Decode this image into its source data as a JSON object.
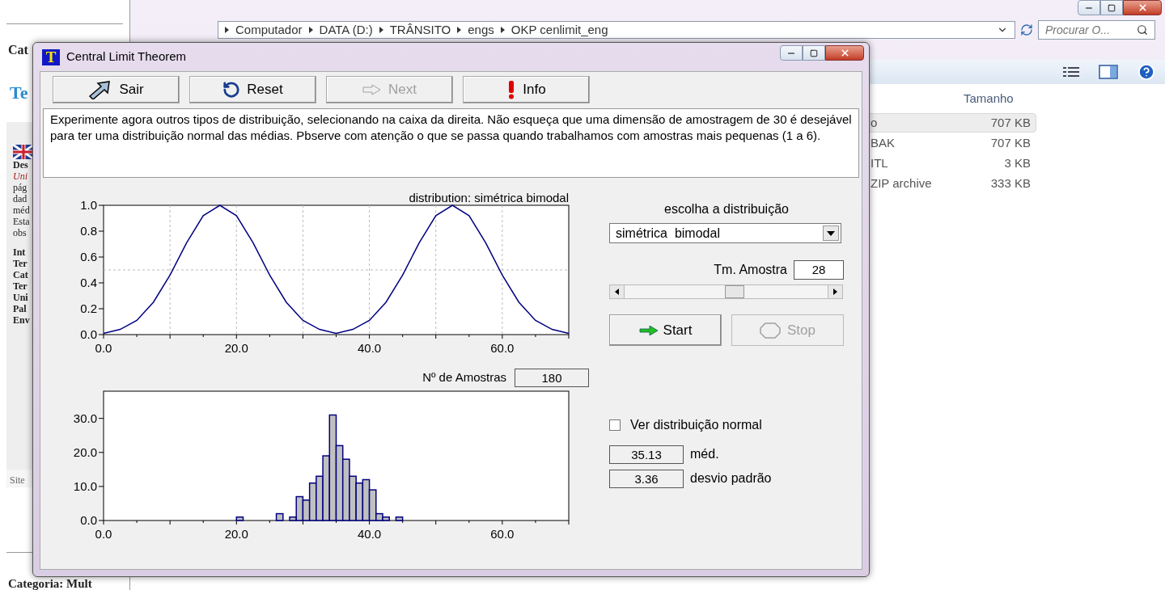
{
  "web_page": {
    "top_label": "Cat",
    "heading": "Te",
    "lines": [
      {
        "text": "Des",
        "kind": "bold"
      },
      {
        "text": "Uni",
        "kind": "italic"
      },
      {
        "text": "pág",
        "kind": "plain"
      },
      {
        "text": "dad",
        "kind": "plain"
      },
      {
        "text": "méd",
        "kind": "plain"
      },
      {
        "text": "Esta",
        "kind": "plain"
      },
      {
        "text": "obs",
        "kind": "plain"
      },
      {
        "text": "Int",
        "kind": "gap"
      },
      {
        "text": "Ter",
        "kind": "bold"
      },
      {
        "text": "Cat",
        "kind": "bold"
      },
      {
        "text": "Ter",
        "kind": "bold"
      },
      {
        "text": "Uni",
        "kind": "bold"
      },
      {
        "text": "Pal",
        "kind": "bold"
      },
      {
        "text": "Env",
        "kind": "bold"
      }
    ],
    "footer": "Site",
    "bottom_label": "Categoria: Mult"
  },
  "explorer": {
    "breadcrumb": [
      "Computador",
      "DATA (D:)",
      "TRÂNSITO",
      "engs",
      "OKP cenlimit_eng"
    ],
    "search": {
      "placeholder": "Procurar O..."
    },
    "column_header": "Tamanho",
    "rows": [
      {
        "type": "o",
        "size": "707 KB",
        "selected": true
      },
      {
        "type": "BAK",
        "size": "707 KB",
        "selected": false
      },
      {
        "type": "ITL",
        "size": "3 KB",
        "selected": false
      },
      {
        "type": "ZIP archive",
        "size": "333 KB",
        "selected": false
      }
    ]
  },
  "dialog": {
    "icon_letter": "T",
    "title": "Central Limit Theorem",
    "toolbar": [
      {
        "label": "Sair",
        "kind": "exit",
        "disabled": false
      },
      {
        "label": "Reset",
        "kind": "reset",
        "disabled": false
      },
      {
        "label": "Next",
        "kind": "next",
        "disabled": true
      },
      {
        "label": "Info",
        "kind": "info",
        "disabled": false
      }
    ],
    "message": "Experimente agora outros tipos de distribuição, selecionando na caixa da direita. Não esqueça que uma dimensão de amostragem de 30 é desejável para ter uma distribuição normal das médias. Pbserve com atenção o que se passa quando trabalhamos com amostras mais pequenas (1 a 6).",
    "distribution_chart": {
      "chart_data": {
        "type": "line",
        "title": "distribution: simétrica  bimodal",
        "x": [
          0,
          2.5,
          5,
          7.5,
          10,
          12.5,
          15,
          17.5,
          20,
          22.5,
          25,
          27.5,
          30,
          32.5,
          35,
          37.5,
          40,
          42.5,
          45,
          47.5,
          50,
          52.5,
          55,
          57.5,
          60,
          62.5,
          65,
          67.5,
          70
        ],
        "grid": true,
        "series": [
          {
            "color": "#000080",
            "values": [
              0.01,
              0.04,
              0.11,
              0.25,
              0.46,
              0.71,
              0.92,
              1,
              0.92,
              0.71,
              0.46,
              0.25,
              0.11,
              0.04,
              0.01,
              0.04,
              0.11,
              0.25,
              0.46,
              0.71,
              0.92,
              1,
              0.92,
              0.71,
              0.46,
              0.25,
              0.11,
              0.04,
              0.01
            ]
          }
        ],
        "xlim": [
          0,
          70
        ],
        "ylim": [
          0,
          1
        ],
        "xticks": [
          {
            "value": 0,
            "label": "0.0"
          },
          {
            "value": 20,
            "label": "20.0"
          },
          {
            "value": 40,
            "label": "40.0"
          },
          {
            "value": 60,
            "label": "60.0"
          }
        ],
        "yticks": [
          {
            "value": 0,
            "label": "0.0"
          },
          {
            "value": 0.2,
            "label": "0.2"
          },
          {
            "value": 0.4,
            "label": "0.4"
          },
          {
            "value": 0.6,
            "label": "0.6"
          },
          {
            "value": 0.8,
            "label": "0.8"
          },
          {
            "value": 1,
            "label": "1.0"
          }
        ]
      }
    },
    "samples_label": "Nº de Amostras",
    "samples_value": "180",
    "histogram": {
      "chart_data": {
        "type": "bar",
        "x": [
          20.5,
          26.5,
          28.5,
          29.5,
          30.5,
          31.5,
          32.5,
          33.5,
          34.5,
          35.5,
          36.5,
          37.5,
          38.5,
          39.5,
          40.5,
          41.5,
          42.5,
          44.5
        ],
        "grid": false,
        "series": [
          {
            "color": "#c0c0c0",
            "values": [
              1,
              2,
              1,
              7,
              6,
              11,
              13,
              19,
              31,
              22,
              18,
              13,
              11,
              12,
              9,
              2,
              1,
              1
            ]
          }
        ],
        "xlim": [
          0,
          70
        ],
        "ylim": [
          0,
          38
        ],
        "xticks": [
          {
            "value": 0,
            "label": "0.0"
          },
          {
            "value": 20,
            "label": "20.0"
          },
          {
            "value": 40,
            "label": "40.0"
          },
          {
            "value": 60,
            "label": "60.0"
          }
        ],
        "yticks": [
          {
            "value": 0,
            "label": "0.0"
          },
          {
            "value": 10,
            "label": "10.0"
          },
          {
            "value": 20,
            "label": "20.0"
          },
          {
            "value": 30,
            "label": "30.0"
          }
        ]
      }
    },
    "choose_label": "escolha a distribuição",
    "distribution_value": "simétrica  bimodal",
    "sample_size_label": "Tm. Amostra",
    "sample_size_value": "28",
    "sample_slider": {
      "level": 0.54
    },
    "start": {
      "label": "Start",
      "disabled": false
    },
    "stop": {
      "label": "Stop",
      "disabled": true
    },
    "normal_checkbox": {
      "label": "Ver distribuição normal",
      "checked": false
    },
    "stats": [
      {
        "value": "35.13",
        "label": "méd."
      },
      {
        "value": "3.36",
        "label": "desvio padrão"
      }
    ]
  }
}
